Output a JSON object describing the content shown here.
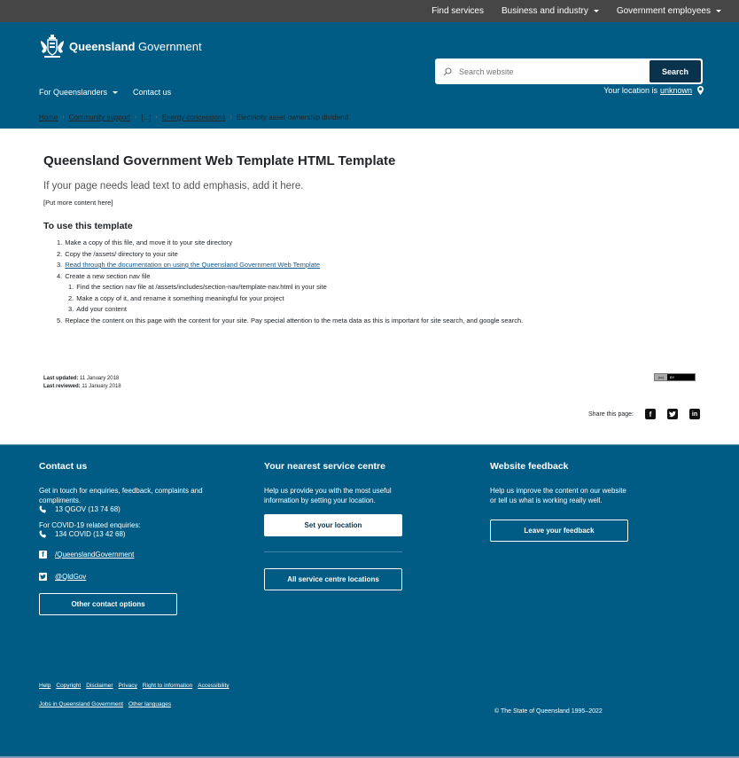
{
  "utility_nav": {
    "items": [
      {
        "label": "Find services",
        "dropdown": false
      },
      {
        "label": "Business and industry",
        "dropdown": true
      },
      {
        "label": "Government employees",
        "dropdown": true
      }
    ]
  },
  "header": {
    "brand_bold": "Queensland",
    "brand_regular": " Government",
    "search": {
      "placeholder": "Search website",
      "value": "",
      "button_label": "Search"
    },
    "main_nav": [
      {
        "label": "For Queenslanders",
        "dropdown": true
      },
      {
        "label": "Contact us",
        "dropdown": false
      }
    ],
    "location": {
      "prefix": "Your location is",
      "value": "unknown"
    }
  },
  "breadcrumb": [
    {
      "label": "Home",
      "link": true
    },
    {
      "label": "Community support",
      "link": true
    },
    {
      "label": "[...]",
      "link": false
    },
    {
      "label": "Energy concessions",
      "link": true
    },
    {
      "label": "Electricity asset ownership dividend",
      "link": false
    }
  ],
  "main": {
    "title": "Queensland Government Web Template HTML Template",
    "lead": "If your page needs lead text to add emphasis, add it here.",
    "placeholder_text": "[Put more content here]",
    "section_heading": "To use this template",
    "steps": [
      {
        "num": "1.",
        "text": "Make a copy of this file, and move it to your site directory"
      },
      {
        "num": "2.",
        "text": "Copy the /assets/ directory to your site"
      },
      {
        "num": "3.",
        "text": "Read through the documentation on using the Queensland Government Web Template",
        "link": true
      },
      {
        "num": "4.",
        "text": "Create a new section nav file"
      },
      {
        "num": "5.",
        "text": "Replace the content on this page with the content for your site. Pay special attention to the meta data as this is important for site search, and google search."
      }
    ],
    "substeps": [
      {
        "num": "1.",
        "text": "Find the section nav file at /assets/includes/section-nav/template-nav.html in your site"
      },
      {
        "num": "2.",
        "text": "Make a copy of it, and rename it something meaningful for your project"
      },
      {
        "num": "3.",
        "text": "Add your content"
      }
    ]
  },
  "meta": {
    "last_updated_label": "Last updated:",
    "last_updated": "11 January 2018",
    "last_reviewed_label": "Last reviewed:",
    "last_reviewed": "11 January 2018",
    "license_badge": {
      "cc": "(cc)",
      "by": "BY"
    }
  },
  "share": {
    "label": "Share this page:",
    "icons": [
      "facebook-icon",
      "twitter-icon",
      "linkedin-icon"
    ]
  },
  "footer": {
    "contact": {
      "heading": "Contact us",
      "intro": "Get in touch for enquiries, feedback, complaints and compliments.",
      "phone": "13 QGOV (13 74 68)",
      "covid_label": "For COVID-19 related enquiries:",
      "covid_phone": "134 COVID (13 42 68)",
      "facebook": "/QueenslandGovernment",
      "twitter": "@QldGov",
      "button": "Other contact options"
    },
    "service_centre": {
      "heading": "Your nearest service centre",
      "text": "Help us provide you with the most useful information by setting your location.",
      "set_location_button": "Set your location",
      "all_locations_button": "All service centre locations"
    },
    "feedback": {
      "heading": "Website feedback",
      "text": "Help us improve the content on our website or tell us what is working really well.",
      "button": "Leave your feedback"
    },
    "links_row1": [
      "Help",
      "Copyright",
      "Disclaimer",
      "Privacy",
      "Right to information",
      "Accessibility"
    ],
    "links_row2": [
      "Jobs in Queensland Government",
      "Other languages"
    ],
    "copyright": "© The State of Queensland 1995–2022"
  },
  "colors": {
    "utility_bar": "#464646",
    "brand_blue": "#005c84",
    "dark_navy": "#09334d",
    "link_blue": "#13578b"
  }
}
